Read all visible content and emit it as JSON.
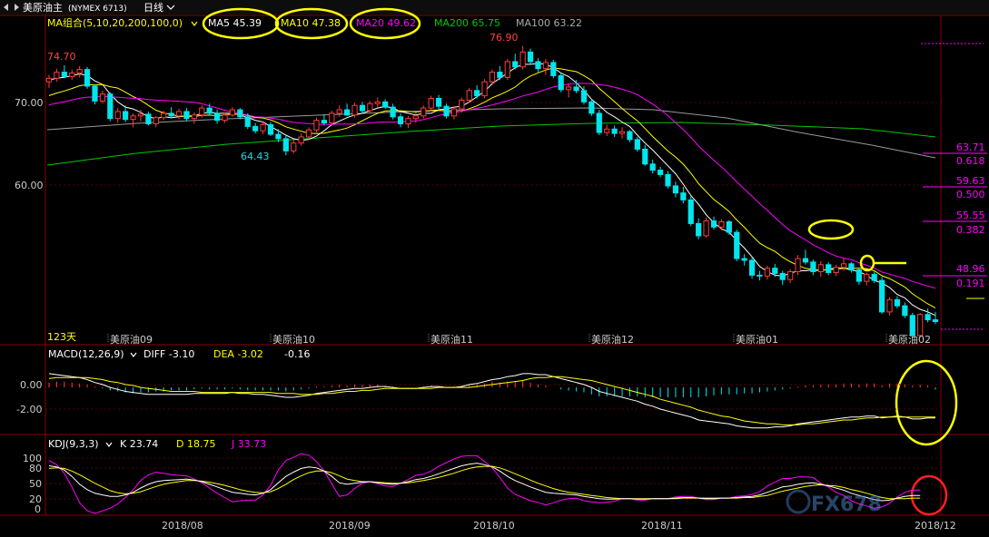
{
  "header": {
    "nav_icon": "expand-arrows-icon",
    "instrument": "美原油主",
    "exchange_code": "(NYMEX 6713)",
    "period": "日线"
  },
  "colors": {
    "background": "#000000",
    "up_candle": "#ff3b3b",
    "down_candle": "#00e5ee",
    "ma5": "#ffffff",
    "ma10": "#ffff00",
    "ma20": "#ff00ff",
    "ma200": "#00c800",
    "ma100": "#aaaaaa",
    "grid": "#6a0000",
    "annotation": "#ffff00",
    "annotation_red": "#ff2020"
  },
  "price_panel": {
    "ma_group_label": "MA组合(5,10,20,200,100,0)",
    "ma5": "MA5 45.39",
    "ma10": "MA10 47.38",
    "ma20": "MA20 49.62",
    "ma200": "MA200 65.75",
    "ma100": "MA100 63.22",
    "y_ticks": [
      "70.00",
      "60.00"
    ],
    "high_label_left": "74.70",
    "low_label": "64.43",
    "high_label": "76.90",
    "bar_count": "123天",
    "contract_labels": [
      "美原油09",
      "美原油10",
      "美原油11",
      "美原油12",
      "美原油01",
      "美原油02"
    ],
    "fib_levels": [
      {
        "price": "63.71",
        "ratio": "0.618"
      },
      {
        "price": "59.63",
        "ratio": "0.500"
      },
      {
        "price": "55.55",
        "ratio": "0.382"
      },
      {
        "price": "48.96",
        "ratio": "0.191"
      }
    ]
  },
  "macd_panel": {
    "label": "MACD(12,26,9)",
    "diff": "DIFF -3.10",
    "dea": "DEA -3.02",
    "macd": "-0.16",
    "y_ticks": [
      "0.00",
      "-2.00"
    ]
  },
  "kdj_panel": {
    "label": "KDJ(9,3,3)",
    "k": "K 23.74",
    "d": "D 18.75",
    "j": "J 33.73",
    "y_ticks": [
      "100",
      "80",
      "50",
      "20",
      "0"
    ]
  },
  "x_axis": {
    "month_labels": [
      "2018/08",
      "2018/09",
      "2018/10",
      "2018/11",
      "2018/12"
    ]
  },
  "watermark": "FX678",
  "chart_data": {
    "type": "candlestick",
    "ylim_price": [
      44,
      78
    ],
    "ylim_macd": [
      -4.5,
      2.5
    ],
    "ylim_kdj": [
      -10,
      110
    ],
    "grid": true,
    "ohlc": [
      [
        72.8,
        73.6,
        72.1,
        73.2
      ],
      [
        73.2,
        74.3,
        72.8,
        73.9
      ],
      [
        73.9,
        74.7,
        73.2,
        73.4
      ],
      [
        73.4,
        74.2,
        73.0,
        73.8
      ],
      [
        73.8,
        74.6,
        73.3,
        74.2
      ],
      [
        74.2,
        74.5,
        72.0,
        72.3
      ],
      [
        72.3,
        72.5,
        70.2,
        70.6
      ],
      [
        70.6,
        71.8,
        70.3,
        71.4
      ],
      [
        71.4,
        71.6,
        68.3,
        68.6
      ],
      [
        68.6,
        69.8,
        68.1,
        69.4
      ],
      [
        69.4,
        70.1,
        68.2,
        68.5
      ],
      [
        68.5,
        69.2,
        67.6,
        68.9
      ],
      [
        68.9,
        69.6,
        68.3,
        69.1
      ],
      [
        69.1,
        69.4,
        67.8,
        68.0
      ],
      [
        68.0,
        68.9,
        67.6,
        68.7
      ],
      [
        68.7,
        69.5,
        68.4,
        69.2
      ],
      [
        69.2,
        69.9,
        68.6,
        68.9
      ],
      [
        68.9,
        69.7,
        68.5,
        69.4
      ],
      [
        69.4,
        69.8,
        68.3,
        68.6
      ],
      [
        68.6,
        69.3,
        68.0,
        69.0
      ],
      [
        69.0,
        70.1,
        68.7,
        69.8
      ],
      [
        69.8,
        70.3,
        68.9,
        69.2
      ],
      [
        69.2,
        69.6,
        68.0,
        68.4
      ],
      [
        68.4,
        69.3,
        68.1,
        69.0
      ],
      [
        69.0,
        69.9,
        68.8,
        69.6
      ],
      [
        69.6,
        69.8,
        68.5,
        68.8
      ],
      [
        68.8,
        69.2,
        67.4,
        67.7
      ],
      [
        67.7,
        68.1,
        66.9,
        67.2
      ],
      [
        67.2,
        68.3,
        66.8,
        67.9
      ],
      [
        67.9,
        68.2,
        66.6,
        66.8
      ],
      [
        66.8,
        67.4,
        65.9,
        66.3
      ],
      [
        66.3,
        66.6,
        64.4,
        64.9
      ],
      [
        64.9,
        66.2,
        64.6,
        65.8
      ],
      [
        65.8,
        66.9,
        65.5,
        66.5
      ],
      [
        66.5,
        67.6,
        66.2,
        67.3
      ],
      [
        67.3,
        68.7,
        67.0,
        68.4
      ],
      [
        68.4,
        69.1,
        67.8,
        68.1
      ],
      [
        68.1,
        69.5,
        67.9,
        69.2
      ],
      [
        69.2,
        70.1,
        68.8,
        69.6
      ],
      [
        69.6,
        70.3,
        68.9,
        69.0
      ],
      [
        69.0,
        70.4,
        68.7,
        70.1
      ],
      [
        70.1,
        70.5,
        69.2,
        69.5
      ],
      [
        69.5,
        70.6,
        69.2,
        70.3
      ],
      [
        70.3,
        71.0,
        69.8,
        70.5
      ],
      [
        70.5,
        70.8,
        69.7,
        69.9
      ],
      [
        69.9,
        70.3,
        68.5,
        68.8
      ],
      [
        68.8,
        69.2,
        67.6,
        68.0
      ],
      [
        68.0,
        68.9,
        67.5,
        68.6
      ],
      [
        68.6,
        69.3,
        68.1,
        68.9
      ],
      [
        68.9,
        70.1,
        68.6,
        69.8
      ],
      [
        69.8,
        71.2,
        69.4,
        70.9
      ],
      [
        70.9,
        71.3,
        69.7,
        70.0
      ],
      [
        70.0,
        70.3,
        68.6,
        68.9
      ],
      [
        68.9,
        70.0,
        68.5,
        69.7
      ],
      [
        69.7,
        71.0,
        69.3,
        70.7
      ],
      [
        70.7,
        72.1,
        70.4,
        71.8
      ],
      [
        71.8,
        72.4,
        70.9,
        71.2
      ],
      [
        71.2,
        73.1,
        70.9,
        72.8
      ],
      [
        72.8,
        74.2,
        72.4,
        73.9
      ],
      [
        73.9,
        74.6,
        73.0,
        73.3
      ],
      [
        73.3,
        75.4,
        73.0,
        75.1
      ],
      [
        75.1,
        76.0,
        74.2,
        74.5
      ],
      [
        74.5,
        76.9,
        74.2,
        76.2
      ],
      [
        76.2,
        76.6,
        74.8,
        75.1
      ],
      [
        75.1,
        75.5,
        73.9,
        74.3
      ],
      [
        74.3,
        75.4,
        73.6,
        75.0
      ],
      [
        75.0,
        75.3,
        73.2,
        73.5
      ],
      [
        73.5,
        73.8,
        71.6,
        71.9
      ],
      [
        71.9,
        72.6,
        71.0,
        72.2
      ],
      [
        72.2,
        73.0,
        71.5,
        71.8
      ],
      [
        71.8,
        72.3,
        70.2,
        70.5
      ],
      [
        70.5,
        70.8,
        68.9,
        69.2
      ],
      [
        69.2,
        69.6,
        66.7,
        67.0
      ],
      [
        67.0,
        67.9,
        66.6,
        67.4
      ],
      [
        67.4,
        67.8,
        66.5,
        66.9
      ],
      [
        66.9,
        67.6,
        66.3,
        67.1
      ],
      [
        67.1,
        67.3,
        65.9,
        66.2
      ],
      [
        66.2,
        66.5,
        64.8,
        65.1
      ],
      [
        65.1,
        65.6,
        63.2,
        63.4
      ],
      [
        63.4,
        63.9,
        62.3,
        62.7
      ],
      [
        62.7,
        63.1,
        61.9,
        62.2
      ],
      [
        62.2,
        62.6,
        60.6,
        60.9
      ],
      [
        60.9,
        61.4,
        59.6,
        60.1
      ],
      [
        60.1,
        60.8,
        58.9,
        59.3
      ],
      [
        59.3,
        59.7,
        56.3,
        56.6
      ],
      [
        56.6,
        57.2,
        54.8,
        55.2
      ],
      [
        55.2,
        57.3,
        55.0,
        56.9
      ],
      [
        56.9,
        57.4,
        55.9,
        56.2
      ],
      [
        56.2,
        57.1,
        55.8,
        56.8
      ],
      [
        56.8,
        57.0,
        55.3,
        55.6
      ],
      [
        55.6,
        55.9,
        52.3,
        52.6
      ],
      [
        52.6,
        53.1,
        51.8,
        52.4
      ],
      [
        52.4,
        52.8,
        50.3,
        50.7
      ],
      [
        50.7,
        51.2,
        50.1,
        50.6
      ],
      [
        50.6,
        51.8,
        50.2,
        51.5
      ],
      [
        51.5,
        52.0,
        50.5,
        50.9
      ],
      [
        50.9,
        51.2,
        49.6,
        50.2
      ],
      [
        50.2,
        51.4,
        49.8,
        51.1
      ],
      [
        51.1,
        53.0,
        50.7,
        52.6
      ],
      [
        52.6,
        53.6,
        51.9,
        52.2
      ],
      [
        52.2,
        52.5,
        50.7,
        51.1
      ],
      [
        51.1,
        52.3,
        50.5,
        51.9
      ],
      [
        51.9,
        52.2,
        50.7,
        51.0
      ],
      [
        51.0,
        51.9,
        50.6,
        51.6
      ],
      [
        51.6,
        52.6,
        51.2,
        52.0
      ],
      [
        52.0,
        52.2,
        51.0,
        51.3
      ],
      [
        51.3,
        51.6,
        49.6,
        50.0
      ],
      [
        50.0,
        51.0,
        49.5,
        50.8
      ],
      [
        50.8,
        51.1,
        49.8,
        50.1
      ],
      [
        50.1,
        50.5,
        46.3,
        46.5
      ],
      [
        46.5,
        48.2,
        46.1,
        47.9
      ],
      [
        47.9,
        48.3,
        46.9,
        47.2
      ],
      [
        47.2,
        47.6,
        45.8,
        46.1
      ],
      [
        46.1,
        46.4,
        43.5,
        43.8
      ],
      [
        43.8,
        46.4,
        43.6,
        46.2
      ],
      [
        46.2,
        46.9,
        45.3,
        45.6
      ],
      [
        45.6,
        46.5,
        45.1,
        45.4
      ]
    ],
    "macd_hist": [
      0.5,
      0.6,
      0.6,
      0.5,
      0.4,
      0.3,
      0.1,
      -0.1,
      -0.3,
      -0.4,
      -0.5,
      -0.6,
      -0.5,
      -0.5,
      -0.4,
      -0.4,
      -0.3,
      -0.3,
      -0.3,
      -0.2,
      -0.1,
      -0.2,
      -0.2,
      -0.2,
      -0.1,
      -0.2,
      -0.3,
      -0.3,
      -0.3,
      -0.3,
      -0.3,
      -0.4,
      -0.3,
      -0.2,
      -0.1,
      0.1,
      0.1,
      0.2,
      0.3,
      0.2,
      0.3,
      0.3,
      0.3,
      0.3,
      0.2,
      0.1,
      0.0,
      0.0,
      0.0,
      0.1,
      0.2,
      0.1,
      0.0,
      0.1,
      0.2,
      0.3,
      0.3,
      0.4,
      0.6,
      0.5,
      0.6,
      0.6,
      0.7,
      0.5,
      0.3,
      0.2,
      0.0,
      -0.2,
      -0.3,
      -0.4,
      -0.5,
      -0.7,
      -0.9,
      -0.9,
      -0.9,
      -0.9,
      -0.9,
      -0.9,
      -1.0,
      -1.0,
      -1.0,
      -1.0,
      -1.0,
      -1.0,
      -1.0,
      -1.0,
      -0.9,
      -0.8,
      -0.7,
      -0.7,
      -0.7,
      -0.6,
      -0.6,
      -0.5,
      -0.4,
      -0.3,
      -0.2,
      -0.1,
      0.1,
      0.2,
      0.2,
      0.3,
      0.3,
      0.3,
      0.4,
      0.4,
      0.3,
      0.4,
      0.4,
      0.2,
      0.4,
      0.4,
      0.3,
      0.2,
      0.3,
      0.2,
      -0.2
    ],
    "macd_diff": [
      1.4,
      1.3,
      1.2,
      1.1,
      1.0,
      0.8,
      0.5,
      0.3,
      0.0,
      -0.2,
      -0.4,
      -0.5,
      -0.6,
      -0.7,
      -0.7,
      -0.7,
      -0.7,
      -0.7,
      -0.7,
      -0.6,
      -0.6,
      -0.6,
      -0.6,
      -0.6,
      -0.5,
      -0.6,
      -0.6,
      -0.7,
      -0.7,
      -0.8,
      -0.9,
      -1.0,
      -1.0,
      -0.9,
      -0.8,
      -0.6,
      -0.5,
      -0.4,
      -0.3,
      -0.2,
      -0.1,
      -0.1,
      0.0,
      0.1,
      0.1,
      0.0,
      -0.1,
      -0.1,
      -0.1,
      0.0,
      0.1,
      0.1,
      0.0,
      0.0,
      0.1,
      0.3,
      0.4,
      0.6,
      0.8,
      0.9,
      1.1,
      1.2,
      1.4,
      1.4,
      1.3,
      1.3,
      1.1,
      0.9,
      0.7,
      0.5,
      0.3,
      0.0,
      -0.4,
      -0.6,
      -0.8,
      -1.0,
      -1.2,
      -1.4,
      -1.7,
      -1.9,
      -2.2,
      -2.4,
      -2.6,
      -2.8,
      -3.0,
      -3.3,
      -3.4,
      -3.5,
      -3.6,
      -3.7,
      -3.9,
      -4.0,
      -4.1,
      -4.1,
      -4.1,
      -4.0,
      -4.0,
      -3.9,
      -3.7,
      -3.6,
      -3.5,
      -3.4,
      -3.3,
      -3.2,
      -3.1,
      -3.0,
      -3.0,
      -2.9,
      -2.9,
      -3.1,
      -3.0,
      -2.9,
      -3.0,
      -3.2,
      -3.2,
      -3.1,
      -3.1
    ],
    "macd_dea": [
      0.9,
      1.0,
      1.0,
      1.0,
      1.0,
      1.0,
      0.9,
      0.8,
      0.6,
      0.5,
      0.3,
      0.2,
      0.0,
      -0.1,
      -0.2,
      -0.3,
      -0.4,
      -0.4,
      -0.4,
      -0.4,
      -0.5,
      -0.5,
      -0.5,
      -0.5,
      -0.5,
      -0.5,
      -0.5,
      -0.5,
      -0.5,
      -0.5,
      -0.6,
      -0.6,
      -0.6,
      -0.7,
      -0.7,
      -0.7,
      -0.6,
      -0.6,
      -0.5,
      -0.4,
      -0.4,
      -0.3,
      -0.3,
      -0.2,
      -0.1,
      -0.1,
      -0.1,
      -0.1,
      -0.1,
      -0.1,
      -0.1,
      0.0,
      0.0,
      0.0,
      0.0,
      0.0,
      0.1,
      0.2,
      0.3,
      0.4,
      0.5,
      0.6,
      0.7,
      0.9,
      1.0,
      1.0,
      1.1,
      1.1,
      1.0,
      0.9,
      0.8,
      0.7,
      0.5,
      0.3,
      0.1,
      -0.1,
      -0.3,
      -0.5,
      -0.7,
      -0.9,
      -1.2,
      -1.4,
      -1.6,
      -1.8,
      -2.0,
      -2.3,
      -2.5,
      -2.7,
      -2.9,
      -3.0,
      -3.2,
      -3.4,
      -3.5,
      -3.6,
      -3.7,
      -3.7,
      -3.8,
      -3.8,
      -3.8,
      -3.7,
      -3.7,
      -3.6,
      -3.5,
      -3.4,
      -3.3,
      -3.3,
      -3.2,
      -3.1,
      -3.1,
      -3.0,
      -3.0,
      -3.0,
      -3.0,
      -3.0,
      -3.0,
      -3.0,
      -3.0
    ],
    "kdj_k": [
      80,
      78,
      72,
      60,
      45,
      35,
      28,
      25,
      22,
      22,
      25,
      30,
      38,
      45,
      50,
      52,
      53,
      54,
      55,
      53,
      50,
      45,
      40,
      35,
      30,
      28,
      26,
      25,
      28,
      35,
      48,
      60,
      68,
      75,
      78,
      76,
      70,
      60,
      48,
      45,
      47,
      49,
      50,
      48,
      46,
      45,
      47,
      50,
      54,
      56,
      60,
      65,
      70,
      75,
      80,
      83,
      85,
      82,
      78,
      70,
      60,
      52,
      46,
      40,
      35,
      30,
      28,
      27,
      26,
      25,
      22,
      20,
      18,
      17,
      17,
      18,
      18,
      17,
      17,
      18,
      18,
      18,
      19,
      20,
      20,
      19,
      18,
      18,
      19,
      19,
      20,
      21,
      22,
      25,
      30,
      35,
      40,
      42,
      45,
      47,
      48,
      45,
      42,
      38,
      34,
      28,
      24,
      20,
      16,
      14,
      15,
      19,
      22,
      24,
      24
    ],
    "kdj_d": [
      75,
      76,
      75,
      70,
      63,
      55,
      47,
      40,
      33,
      29,
      27,
      28,
      31,
      36,
      41,
      45,
      48,
      50,
      52,
      52,
      51,
      49,
      46,
      43,
      39,
      35,
      32,
      30,
      29,
      31,
      37,
      45,
      54,
      61,
      67,
      70,
      70,
      67,
      61,
      55,
      52,
      50,
      50,
      49,
      48,
      47,
      47,
      48,
      50,
      52,
      55,
      58,
      62,
      66,
      71,
      75,
      78,
      79,
      79,
      76,
      71,
      65,
      59,
      53,
      47,
      42,
      37,
      33,
      30,
      28,
      26,
      24,
      22,
      20,
      19,
      18,
      18,
      18,
      18,
      18,
      18,
      18,
      18,
      19,
      19,
      19,
      19,
      19,
      19,
      19,
      19,
      20,
      20,
      22,
      24,
      28,
      32,
      35,
      38,
      41,
      43,
      44,
      43,
      42,
      39,
      35,
      32,
      28,
      24,
      20,
      18,
      18,
      18,
      19,
      19
    ],
    "kdj_j": [
      90,
      82,
      66,
      40,
      10,
      -5,
      -10,
      -5,
      0,
      8,
      20,
      35,
      52,
      63,
      68,
      66,
      63,
      62,
      61,
      55,
      48,
      38,
      28,
      20,
      12,
      14,
      15,
      15,
      25,
      43,
      72,
      90,
      96,
      103,
      100,
      88,
      70,
      46,
      22,
      25,
      37,
      47,
      50,
      46,
      42,
      41,
      47,
      54,
      62,
      64,
      70,
      79,
      86,
      93,
      98,
      99,
      99,
      88,
      76,
      58,
      38,
      26,
      20,
      14,
      11,
      6,
      10,
      15,
      18,
      19,
      14,
      12,
      10,
      11,
      13,
      18,
      18,
      15,
      15,
      18,
      18,
      18,
      21,
      22,
      22,
      19,
      16,
      16,
      19,
      19,
      22,
      23,
      26,
      31,
      42,
      49,
      56,
      56,
      59,
      59,
      58,
      47,
      40,
      30,
      24,
      14,
      8,
      4,
      0,
      2,
      9,
      21,
      30,
      34,
      34
    ],
    "ma5": [
      73.0,
      73.2,
      73.3,
      73.5,
      73.7,
      73.5,
      72.9,
      72.5,
      71.4,
      70.5,
      69.9,
      69.7,
      69.3,
      68.8,
      68.6,
      68.8,
      68.7,
      68.8,
      68.9,
      68.9,
      69.2,
      69.3,
      69.2,
      69.2,
      69.2,
      69.0,
      68.7,
      68.4,
      68.2,
      67.7,
      67.2,
      66.7,
      66.3,
      66.1,
      66.2,
      66.6,
      67.2,
      67.9,
      68.3,
      68.7,
      69.0,
      69.2,
      69.5,
      69.8,
      70.0,
      69.8,
      69.4,
      69.2,
      69.0,
      69.2,
      69.2,
      69.6,
      69.7,
      69.9,
      70.0,
      70.5,
      71.1,
      71.7,
      72.6,
      73.2,
      73.8,
      74.4,
      74.8,
      74.8,
      74.9,
      74.8,
      74.4,
      73.8,
      73.4,
      72.7,
      71.8,
      70.8,
      70.1,
      69.3,
      68.8,
      68.2,
      67.7,
      66.7,
      65.8,
      65.0,
      64.1,
      63.2,
      62.3,
      61.1,
      59.8,
      58.8,
      57.6,
      56.7,
      56.0,
      55.6,
      54.7,
      53.8,
      52.8,
      51.7,
      51.1,
      50.7,
      50.6,
      50.9,
      51.2,
      51.2,
      51.3,
      51.2,
      51.4,
      51.5,
      51.5,
      51.3,
      51.1,
      50.7,
      50.1,
      49.8,
      49.3,
      48.5,
      48.1,
      47.3,
      46.8,
      46.5,
      46.1
    ]
  }
}
